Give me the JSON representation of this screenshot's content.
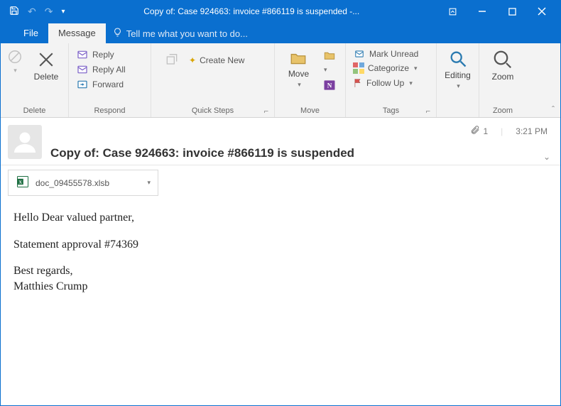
{
  "window": {
    "title": "Copy of: Case 924663: invoice #866119 is suspended -..."
  },
  "tabs": {
    "file": "File",
    "message": "Message",
    "tell_me": "Tell me what you want to do..."
  },
  "ribbon": {
    "delete": {
      "label": "Delete",
      "btn": "Delete"
    },
    "respond": {
      "label": "Respond",
      "reply": "Reply",
      "reply_all": "Reply All",
      "forward": "Forward"
    },
    "quick_steps": {
      "label": "Quick Steps",
      "create_new": "Create New"
    },
    "move": {
      "label": "Move",
      "btn": "Move"
    },
    "tags": {
      "label": "Tags",
      "mark_unread": "Mark Unread",
      "categorize": "Categorize",
      "follow_up": "Follow Up"
    },
    "editing": {
      "label": "Editing",
      "btn": "Editing"
    },
    "zoom": {
      "label": "Zoom",
      "btn": "Zoom"
    }
  },
  "message": {
    "subject": "Copy of: Case 924663: invoice #866119 is suspended",
    "attachment_count": "1",
    "time": "3:21 PM",
    "attachment_name": "doc_09455578.xlsb",
    "body": {
      "line1": "Hello Dear valued partner,",
      "line2": "Statement approval #74369",
      "line3": "Best regards,",
      "line4": "Matthies Crump"
    }
  }
}
